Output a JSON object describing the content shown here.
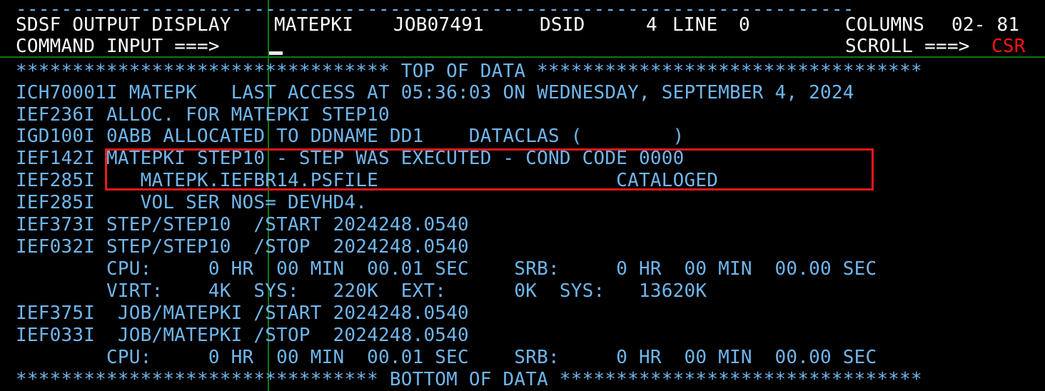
{
  "terminal": {
    "title": "SDSF OUTPUT DISPLAY",
    "background_color": "#000000",
    "header_text_color": "#ffffff",
    "body_text_color": "#6fb6ec",
    "accent_color": "#ff1414",
    "rule_color": "#15a015",
    "highlight_box_color": "#f01818",
    "columns": 80,
    "rows": 18
  },
  "header": {
    "panel_title": "SDSF OUTPUT DISPLAY",
    "jobname": "MATEPKI",
    "jobid": "JOB07491",
    "dsid_label": "DSID",
    "dsid_value": "4",
    "line_label": "LINE",
    "line_value": "0",
    "columns_label": "COLUMNS",
    "columns_value": "02- 81",
    "command_label": "COMMAND INPUT ===>",
    "command_value": "",
    "scroll_label": "SCROLL ===>",
    "scroll_value": "CSR"
  },
  "lines": {
    "top_rule": "--------------------------------------------------------------------------",
    "header_line_1": " SDSF OUTPUT DISPLAY MATEPKI  JOB07491  DSID     4 LINE 0       COLUMNS 02- 81",
    "header_line_2": " COMMAND INPUT ===>                                            SCROLL ===> ",
    "header_line_2_scroll": "CSR",
    "top_of_data": "********************************* TOP OF DATA **********************************",
    "body": [
      "ICH70001I MATEPK   LAST ACCESS AT 05:36:03 ON WEDNESDAY, SEPTEMBER 4, 2024",
      "IEF236I ALLOC. FOR MATEPKI STEP10",
      "IGD100I 0ABB ALLOCATED TO DDNAME DD1    DATACLAS (        )",
      "IEF142I MATEPKI STEP10 - STEP WAS EXECUTED - COND CODE 0000",
      "IEF285I    MATEPK.IEFBR14.PSFILE                     CATALOGED",
      "IEF285I    VOL SER NOS= DEVHD4.",
      "IEF373I STEP/STEP10  /START 2024248.0540",
      "IEF032I STEP/STEP10  /STOP  2024248.0540",
      "        CPU:     0 HR  00 MIN  00.01 SEC    SRB:     0 HR  00 MIN  00.00 SEC",
      "        VIRT:    4K  SYS:   220K  EXT:      0K  SYS:   13620K",
      "IEF375I  JOB/MATEPKI /START 2024248.0540",
      "IEF033I  JOB/MATEPKI /STOP  2024248.0540",
      "        CPU:     0 HR  00 MIN  00.01 SEC    SRB:     0 HR  00 MIN  00.00 SEC"
    ],
    "bottom_of_data": "******************************** BOTTOM OF DATA ********************************"
  },
  "highlight": {
    "note": "red rectangle around step execution and cataloged dataset lines",
    "enclosed_lines": [
      "IEF142I MATEPKI STEP10 - STEP WAS EXECUTED - COND CODE 0000",
      "IEF285I    MATEPK.IEFBR14.PSFILE                     CATALOGED"
    ]
  }
}
